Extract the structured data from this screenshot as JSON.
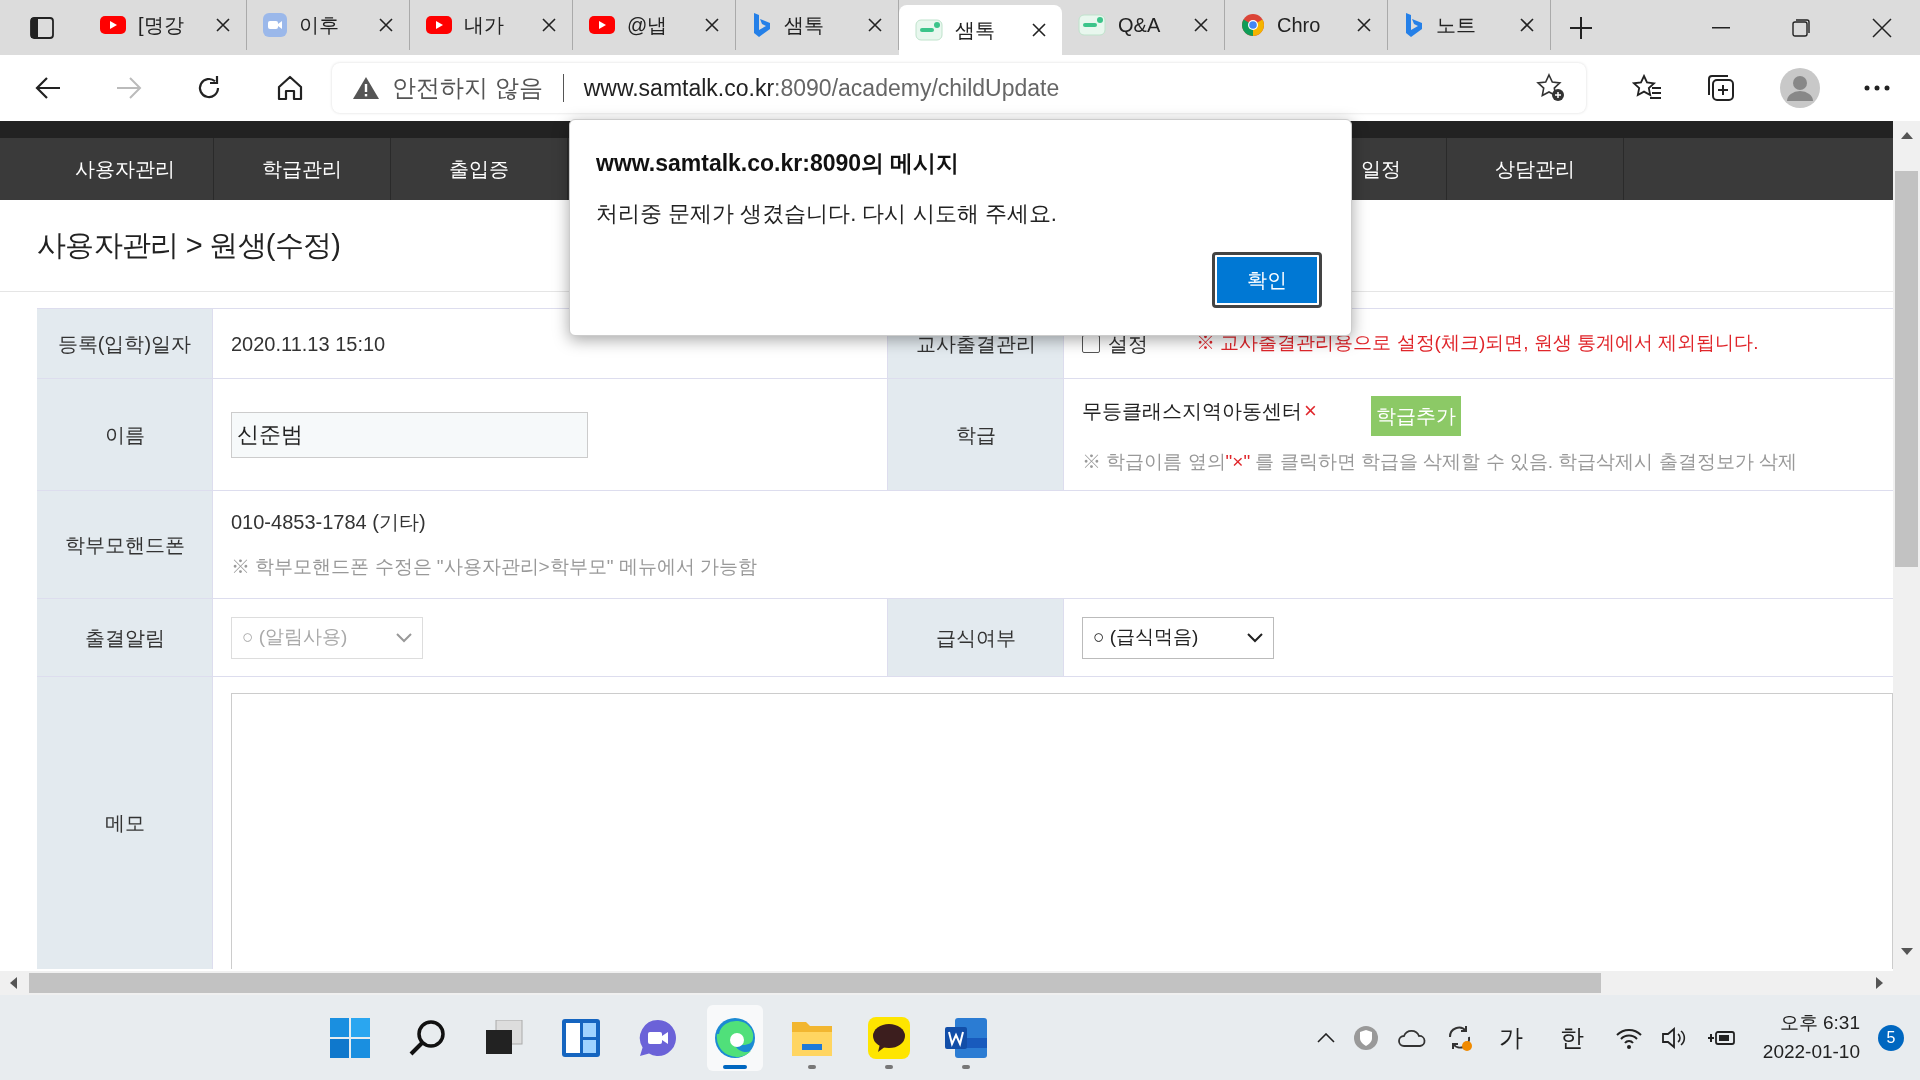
{
  "tabs": [
    {
      "label": "[명강",
      "kind": "youtube",
      "selected": false
    },
    {
      "label": "이후",
      "kind": "camera",
      "selected": false
    },
    {
      "label": "내가",
      "kind": "youtube",
      "selected": false
    },
    {
      "label": "@냅",
      "kind": "youtube",
      "selected": false
    },
    {
      "label": "샘톡",
      "kind": "bing",
      "selected": false
    },
    {
      "label": "샘톡",
      "kind": "sam",
      "selected": true
    },
    {
      "label": "Q&A",
      "kind": "sam",
      "selected": false
    },
    {
      "label": "Chro",
      "kind": "chrome",
      "selected": false
    },
    {
      "label": "노트",
      "kind": "bing",
      "selected": false
    }
  ],
  "address_bar": {
    "security": "안전하지 않음",
    "host": "www.samtalk.co.kr",
    "path": ":8090/academy/childUpdate"
  },
  "nav": [
    {
      "label": "사용자관리"
    },
    {
      "label": "학급관리"
    },
    {
      "label": "출입증"
    },
    {
      "label": "일정"
    },
    {
      "label": "상담관리"
    }
  ],
  "breadcrumb": "사용자관리 > 원생(수정)",
  "form": {
    "reg_date": {
      "label": "등록(입학)일자",
      "value": "2020.11.13 15:10"
    },
    "teacher_attendance": {
      "label": "교사출결관리",
      "checkbox": "설정",
      "checked": false,
      "note": "※ 교사출결관리용으로 설정(체크)되면, 원생 통계에서 제외됩니다."
    },
    "name": {
      "label": "이름",
      "value": "신준범"
    },
    "class": {
      "label": "학급",
      "class_name": "무등클래스지역아동센터",
      "remove": "×",
      "add_button": "학급추가",
      "hint_before": "※ 학급이름 옆의",
      "hint_mark": "\"×\"",
      "hint_after": " 를 클릭하면 학급을 삭제할 수 있음. 학급삭제시 출결정보가 삭제"
    },
    "parent_phone": {
      "label": "학부모핸드폰",
      "value": "010-4853-1784 (기타)",
      "hint": "※ 학부모핸드폰 수정은 \"사용자관리>학부모\" 메뉴에서 가능함"
    },
    "attendance_alert": {
      "label": "출결알림",
      "value": "○ (알림사용)",
      "disabled": true
    },
    "meal": {
      "label": "급식여부",
      "value": "○ (급식먹음)",
      "disabled": false
    },
    "memo": {
      "label": "메모"
    }
  },
  "dialog": {
    "title": "www.samtalk.co.kr:8090의 메시지",
    "message": "처리중 문제가 생겼습니다. 다시 시도해 주세요.",
    "button": "확인"
  },
  "taskbar": {
    "apps": [
      {
        "kind": "start",
        "active": false
      },
      {
        "kind": "search",
        "active": false
      },
      {
        "kind": "taskview",
        "active": false
      },
      {
        "kind": "widgets",
        "active": false
      },
      {
        "kind": "chat",
        "active": false
      },
      {
        "kind": "edge",
        "active": true
      },
      {
        "kind": "folder",
        "active": false
      },
      {
        "kind": "talk",
        "active": false
      },
      {
        "kind": "word",
        "active": false
      }
    ],
    "ime_1": "가",
    "ime_2": "한",
    "time": "오후 6:31",
    "date": "2022-01-10",
    "notifications": "5"
  }
}
